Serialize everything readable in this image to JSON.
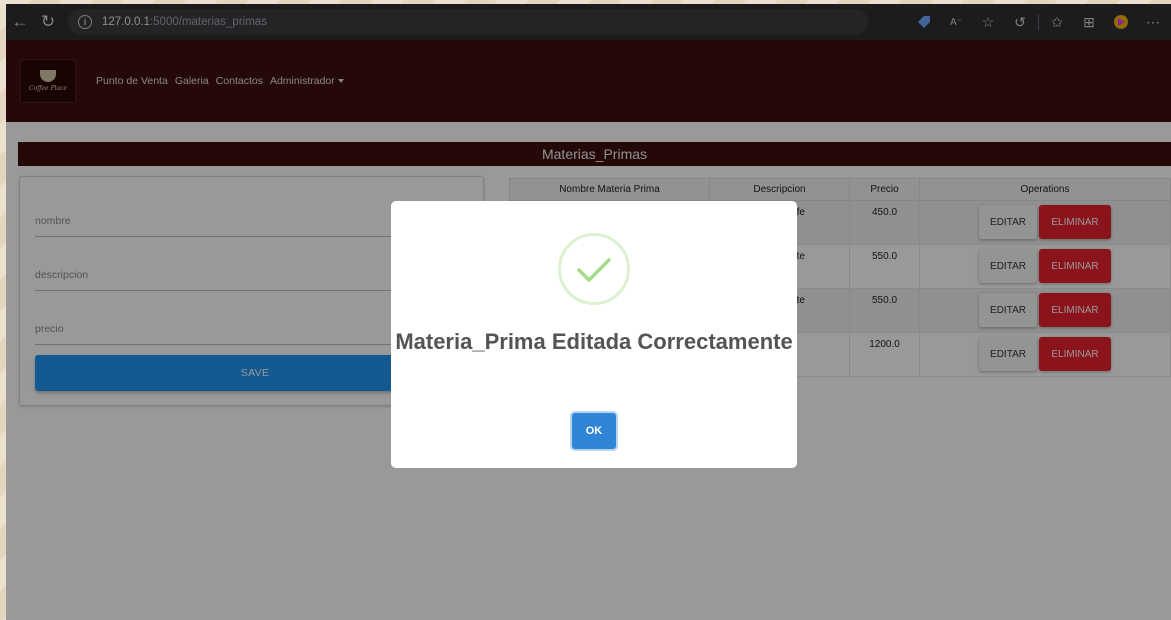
{
  "browser": {
    "url_host": "127.0.0.1",
    "url_path": ":5000/materias_primas"
  },
  "navbar": {
    "logo_text": "Coffee Place",
    "links": [
      "Punto de Venta",
      "Galeria",
      "Contactos",
      "Administrador"
    ]
  },
  "page": {
    "title": "Materias_Primas"
  },
  "form": {
    "nombre_placeholder": "nombre",
    "descripcion_placeholder": "descripcion",
    "precio_placeholder": "precio",
    "save_label": "SAVE"
  },
  "table": {
    "headers": [
      "Nombre Materia Prima",
      "Descripcion",
      "Precio",
      "Operations"
    ],
    "rows": [
      {
        "nombre": "",
        "descripcion": "afe",
        "precio": "450.0"
      },
      {
        "nombre": "",
        "descripcion": "nte",
        "precio": "550.0"
      },
      {
        "nombre": "",
        "descripcion": "nte",
        "precio": "550.0"
      },
      {
        "nombre": "",
        "descripcion": "",
        "precio": "1200.0"
      }
    ],
    "edit_label": "EDITAR",
    "delete_label": "ELIMINAR"
  },
  "modal": {
    "title": "Materia_Prima Editada Correctamente",
    "ok_label": "OK",
    "icon": "success-check-icon"
  },
  "colors": {
    "navbar": "#3e0f0f",
    "save_button": "#2196f3",
    "delete_button": "#e8212e",
    "ok_button": "#3085d6",
    "success_check": "#a5dc86"
  }
}
